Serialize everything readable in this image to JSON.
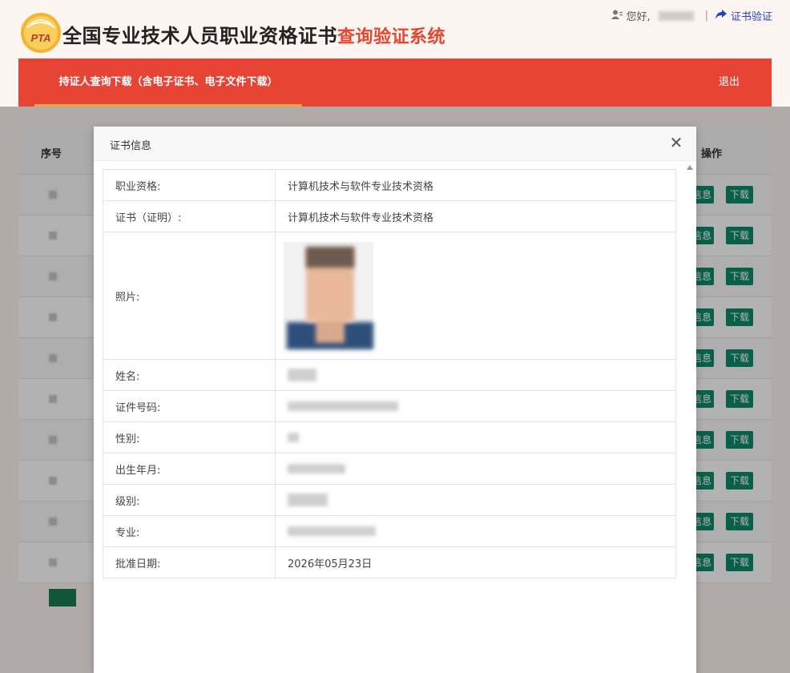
{
  "header": {
    "logo_text": "PTA",
    "title_main": "全国专业技术人员职业资格证书",
    "title_accent": "查询验证系统",
    "greeting": "您好,",
    "verify_link": "证书验证"
  },
  "nav": {
    "tab": "持证人查询下载（含电子证书、电子文件下载）",
    "logout": "退出"
  },
  "table": {
    "col_no": "序号",
    "col_op": "操作",
    "btn_info": "信息",
    "btn_download": "下载",
    "row_count": 10
  },
  "modal": {
    "title": "证书信息",
    "fields": {
      "qualification_label": "职业资格:",
      "qualification_value": "计算机技术与软件专业技术资格",
      "certificate_label": "证书（证明）:",
      "certificate_value": "计算机技术与软件专业技术资格",
      "photo_label": "照片:",
      "name_label": "姓名:",
      "id_label": "证件号码:",
      "gender_label": "性别:",
      "birth_label": "出生年月:",
      "level_label": "级别:",
      "major_label": "专业:",
      "approval_label": "批准日期:",
      "approval_value": "2026年05月23日"
    }
  },
  "colors": {
    "brand_red": "#e84436",
    "accent_orange": "#f5a23c",
    "button_green": "#0d8a6a",
    "link_blue": "#2442c4"
  }
}
